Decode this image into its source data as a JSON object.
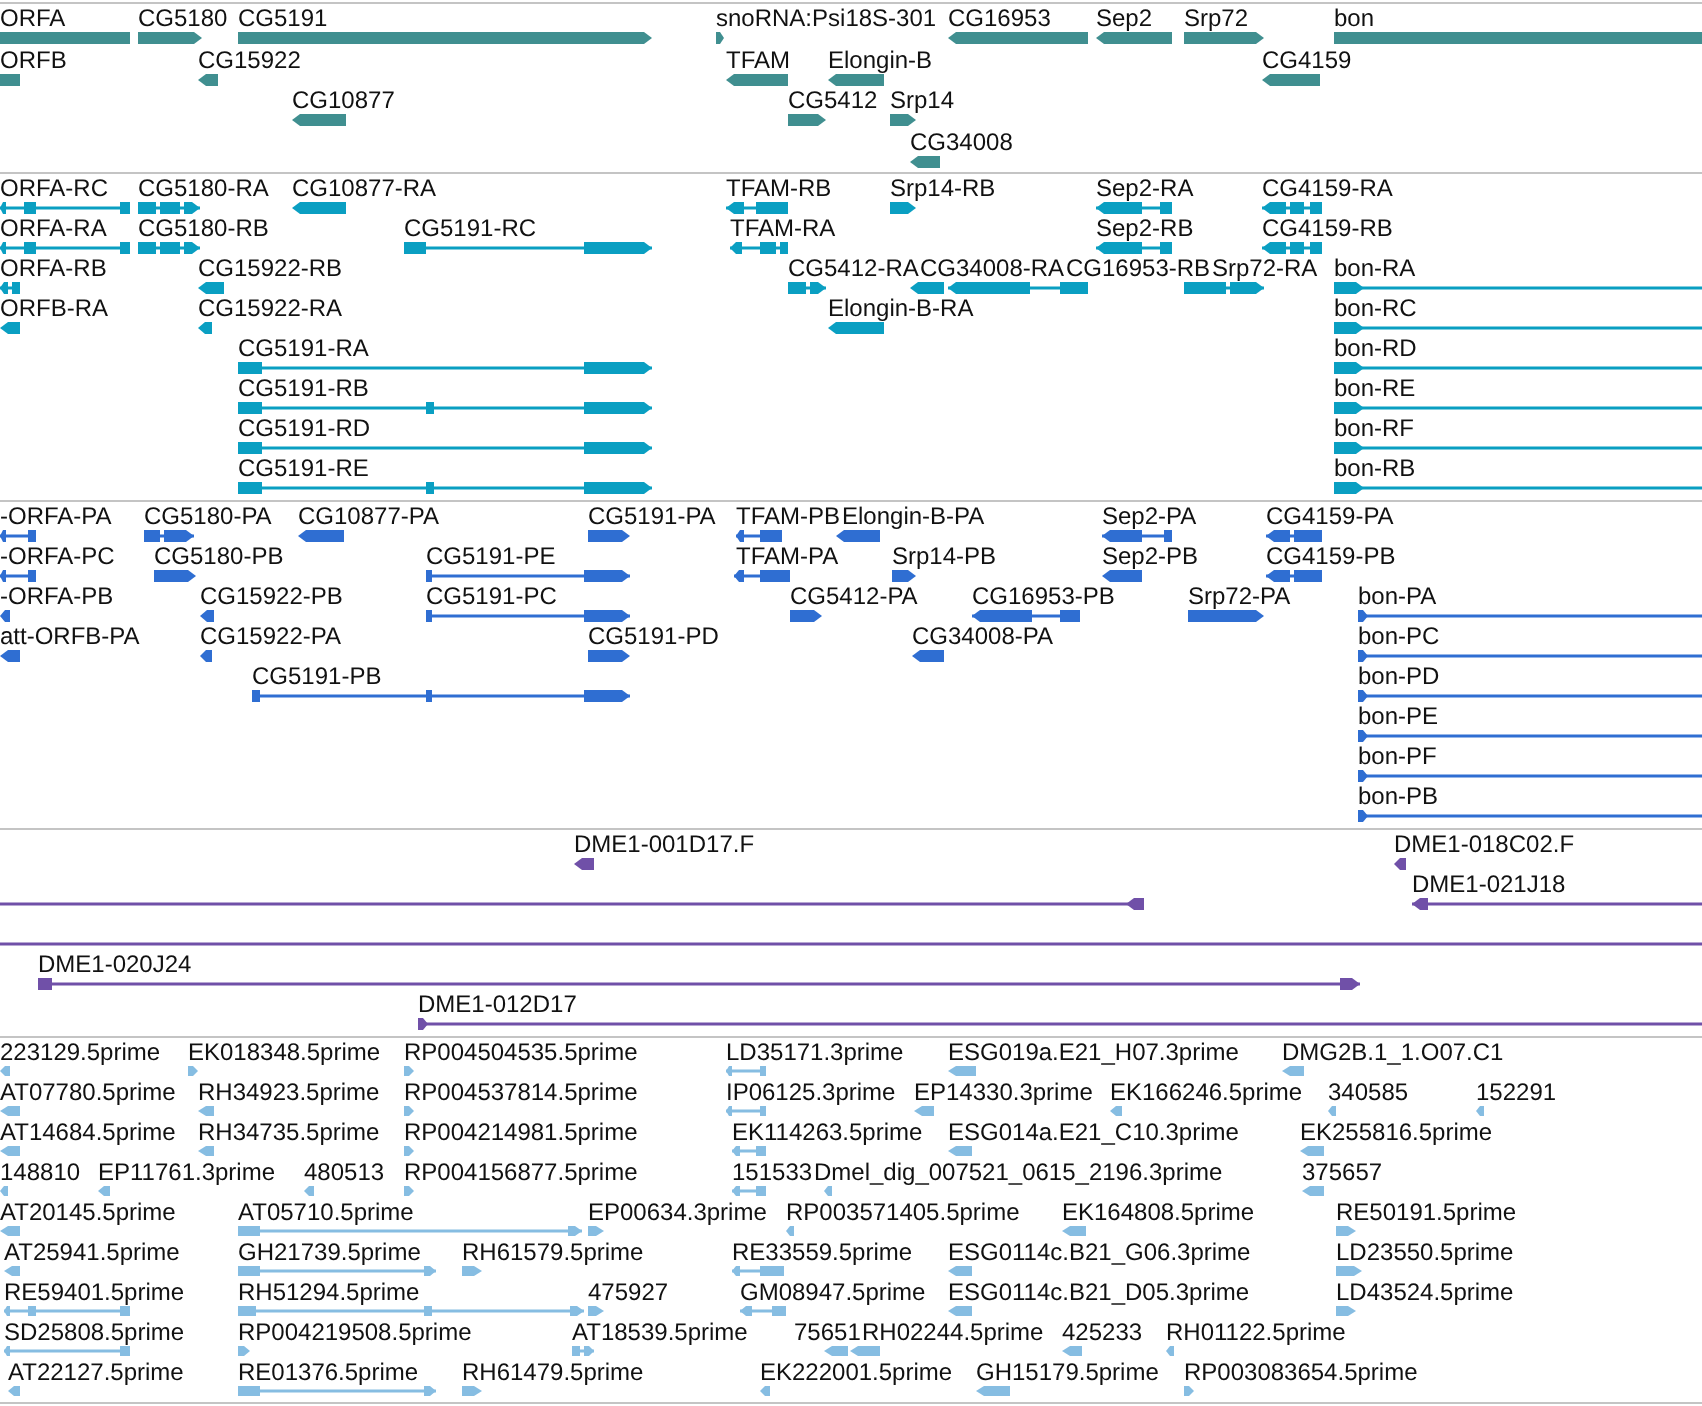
{
  "tracks": [
    {
      "kind": "gene",
      "features": [
        {
          "label": "ORFA"
        },
        {
          "label": "CG5180"
        },
        {
          "label": "CG5191"
        },
        {
          "label": "snoRNA:Psi18S-301"
        },
        {
          "label": "CG16953"
        },
        {
          "label": "Sep2"
        },
        {
          "label": "Srp72"
        },
        {
          "label": "bon"
        },
        {
          "label": "ORFB"
        },
        {
          "label": "CG15922"
        },
        {
          "label": "TFAM"
        },
        {
          "label": "Elongin-B"
        },
        {
          "label": "CG4159"
        },
        {
          "label": "CG10877"
        },
        {
          "label": "CG5412"
        },
        {
          "label": "Srp14"
        },
        {
          "label": "CG34008"
        }
      ]
    },
    {
      "kind": "transcript",
      "features": [
        {
          "label": "ORFA-RC"
        },
        {
          "label": "CG5180-RA"
        },
        {
          "label": "CG10877-RA"
        },
        {
          "label": "TFAM-RB"
        },
        {
          "label": "Srp14-RB"
        },
        {
          "label": "Sep2-RA"
        },
        {
          "label": "CG4159-RA"
        },
        {
          "label": "ORFA-RA"
        },
        {
          "label": "CG5180-RB"
        },
        {
          "label": "CG5191-RC"
        },
        {
          "label": "TFAM-RA"
        },
        {
          "label": "Sep2-RB"
        },
        {
          "label": "CG4159-RB"
        },
        {
          "label": "ORFA-RB"
        },
        {
          "label": "CG15922-RB"
        },
        {
          "label": "CG5412-RA"
        },
        {
          "label": "CG34008-RA"
        },
        {
          "label": "CG16953-RB"
        },
        {
          "label": "Srp72-RA"
        },
        {
          "label": "bon-RA"
        },
        {
          "label": "ORFB-RA"
        },
        {
          "label": "CG15922-RA"
        },
        {
          "label": "Elongin-B-RA"
        },
        {
          "label": "bon-RC"
        },
        {
          "label": "CG5191-RA"
        },
        {
          "label": "bon-RD"
        },
        {
          "label": "CG5191-RB"
        },
        {
          "label": "bon-RE"
        },
        {
          "label": "CG5191-RD"
        },
        {
          "label": "bon-RF"
        },
        {
          "label": "CG5191-RE"
        },
        {
          "label": "bon-RB"
        }
      ]
    },
    {
      "kind": "protein",
      "features": [
        {
          "label": "-ORFA-PA"
        },
        {
          "label": "CG5180-PA"
        },
        {
          "label": "CG10877-PA"
        },
        {
          "label": "CG5191-PA"
        },
        {
          "label": "TFAM-PB"
        },
        {
          "label": "Elongin-B-PA"
        },
        {
          "label": "Sep2-PA"
        },
        {
          "label": "CG4159-PA"
        },
        {
          "label": "-ORFA-PC"
        },
        {
          "label": "CG5180-PB"
        },
        {
          "label": "CG5191-PE"
        },
        {
          "label": "TFAM-PA"
        },
        {
          "label": "Srp14-PB"
        },
        {
          "label": "Sep2-PB"
        },
        {
          "label": "CG4159-PB"
        },
        {
          "label": "-ORFA-PB"
        },
        {
          "label": "CG15922-PB"
        },
        {
          "label": "CG5191-PC"
        },
        {
          "label": "CG5412-PA"
        },
        {
          "label": "CG16953-PB"
        },
        {
          "label": "Srp72-PA"
        },
        {
          "label": "bon-PA"
        },
        {
          "label": "att-ORFB-PA"
        },
        {
          "label": "CG15922-PA"
        },
        {
          "label": "CG5191-PD"
        },
        {
          "label": "CG34008-PA"
        },
        {
          "label": "bon-PC"
        },
        {
          "label": "CG5191-PB"
        },
        {
          "label": "bon-PD"
        },
        {
          "label": "bon-PE"
        },
        {
          "label": "bon-PF"
        },
        {
          "label": "bon-PB"
        }
      ]
    },
    {
      "kind": "clone",
      "features": [
        {
          "label": "DME1-001D17.F"
        },
        {
          "label": "DME1-018C02.F"
        },
        {
          "label": "DME1-021J18"
        },
        {
          "label": "DME1-020J24"
        },
        {
          "label": "DME1-012D17"
        }
      ]
    },
    {
      "kind": "est",
      "features": [
        {
          "label": "223129.5prime"
        },
        {
          "label": "EK018348.5prime"
        },
        {
          "label": "RP004504535.5prime"
        },
        {
          "label": "LD35171.3prime"
        },
        {
          "label": "ESG019a.E21_H07.3prime"
        },
        {
          "label": "DMG2B.1_1.O07.C1"
        },
        {
          "label": "AT07780.5prime"
        },
        {
          "label": "RH34923.5prime"
        },
        {
          "label": "RP004537814.5prime"
        },
        {
          "label": "IP06125.3prime"
        },
        {
          "label": "EP14330.3prime"
        },
        {
          "label": "EK166246.5prime"
        },
        {
          "label": "340585"
        },
        {
          "label": "152291"
        },
        {
          "label": "AT14684.5prime"
        },
        {
          "label": "RH34735.5prime"
        },
        {
          "label": "RP004214981.5prime"
        },
        {
          "label": "EK114263.5prime"
        },
        {
          "label": "ESG014a.E21_C10.3prime"
        },
        {
          "label": "EK255816.5prime"
        },
        {
          "label": "148810"
        },
        {
          "label": "EP11761.3prime"
        },
        {
          "label": "480513"
        },
        {
          "label": "RP004156877.5prime"
        },
        {
          "label": "151533"
        },
        {
          "label": "Dmel_dig_007521_0615_2196.3prime"
        },
        {
          "label": "375657"
        },
        {
          "label": "AT20145.5prime"
        },
        {
          "label": "AT05710.5prime"
        },
        {
          "label": "EP00634.3prime"
        },
        {
          "label": "RP003571405.5prime"
        },
        {
          "label": "EK164808.5prime"
        },
        {
          "label": "RE50191.5prime"
        },
        {
          "label": "AT25941.5prime"
        },
        {
          "label": "GH21739.5prime"
        },
        {
          "label": "RH61579.5prime"
        },
        {
          "label": "RE33559.5prime"
        },
        {
          "label": "ESG0114c.B21_G06.3prime"
        },
        {
          "label": "LD23550.5prime"
        },
        {
          "label": "RE59401.5prime"
        },
        {
          "label": "RH51294.5prime"
        },
        {
          "label": "475927"
        },
        {
          "label": "GM08947.5prime"
        },
        {
          "label": "ESG0114c.B21_D05.3prime"
        },
        {
          "label": "LD43524.5prime"
        },
        {
          "label": "SD25808.5prime"
        },
        {
          "label": "RP004219508.5prime"
        },
        {
          "label": "AT18539.5prime"
        },
        {
          "label": "75651"
        },
        {
          "label": "RH02244.5prime"
        },
        {
          "label": "425233"
        },
        {
          "label": "RH01122.5prime"
        },
        {
          "label": "AT22127.5prime"
        },
        {
          "label": "RE01376.5prime"
        },
        {
          "label": "RH61479.5prime"
        },
        {
          "label": "EK222001.5prime"
        },
        {
          "label": "GH15179.5prime"
        },
        {
          "label": "RP003083654.5prime"
        }
      ]
    }
  ]
}
